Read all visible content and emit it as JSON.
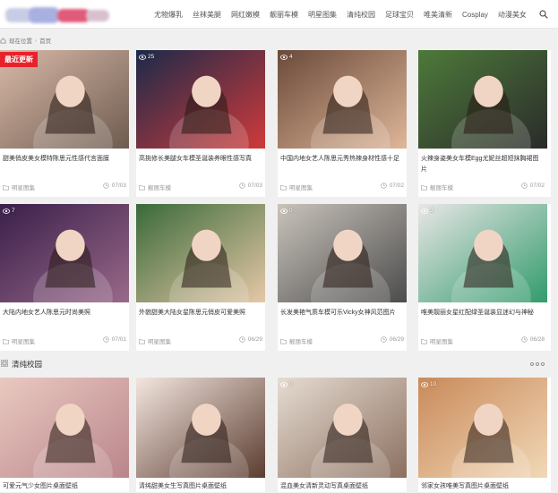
{
  "nav": {
    "items": [
      "尤物爆乳",
      "丝袜美腿",
      "网红嫩模",
      "靓丽车模",
      "明星图集",
      "清纯校园",
      "足球宝贝",
      "唯美清新",
      "Cosplay",
      "动漫美女"
    ]
  },
  "breadcrumb": {
    "current_label": "现在位置",
    "home_label": "首页"
  },
  "badge_new": "最近更新",
  "section": {
    "title": "清纯校园"
  },
  "cards": [
    {
      "title": "甜美俏皮美女模特陈思元性感代言面膜",
      "category": "明星图集",
      "date": "07/03",
      "views": "",
      "bg1": "#d9b9a8",
      "bg2": "#6c5a4e"
    },
    {
      "title": "高挑修长美腿女车模圣诞装养眼性感写真",
      "category": "靓丽车模",
      "date": "07/03",
      "views": "25",
      "bg1": "#1b2a4a",
      "bg2": "#d23a3a"
    },
    {
      "title": "中国内地女艺人陈思元秀热辣身材性感十足",
      "category": "明星图集",
      "date": "07/02",
      "views": "4",
      "bg1": "#6b4a3a",
      "bg2": "#e0b89a"
    },
    {
      "title": "火辣身姿美女车模Egg尤妮丝超短抹胸裙图片",
      "category": "靓丽车模",
      "date": "07/02",
      "views": "",
      "bg1": "#4d7a3a",
      "bg2": "#2a2a2a"
    },
    {
      "title": "大陆内地女艺人陈思元时尚美照",
      "category": "明星图集",
      "date": "07/01",
      "views": "7",
      "bg1": "#3a1f4a",
      "bg2": "#9a6a8a"
    },
    {
      "title": "外貌甜美大陆女星陈思元俏皮可爱美照",
      "category": "明星图集",
      "date": "06/29",
      "views": "",
      "bg1": "#3a6a3a",
      "bg2": "#e8c9a8"
    },
    {
      "title": "长发美艳气质车模可乐Vicky女神风范图片",
      "category": "靓丽车模",
      "date": "06/29",
      "views": "0",
      "bg1": "#c9c3bb",
      "bg2": "#4a4a4a"
    },
    {
      "title": "唯美靓丽女星红配绿圣诞装显迷幻与神秘",
      "category": "明星图集",
      "date": "06/28",
      "views": "3",
      "bg1": "#e9e6e6",
      "bg2": "#2f9a6a"
    }
  ],
  "cards2": [
    {
      "title": "可爱元气少女图片桌面壁纸",
      "views": "",
      "bg1": "#e9c9c0",
      "bg2": "#b9848a"
    },
    {
      "title": "清纯甜美女生写真图片桌面壁纸",
      "views": "",
      "bg1": "#f3e6df",
      "bg2": "#5a3a2e"
    },
    {
      "title": "混血美女清新灵动写真桌面壁纸",
      "views": "0",
      "bg1": "#e6dcd2",
      "bg2": "#8a6e5e"
    },
    {
      "title": "邻家女孩唯美写真图片桌面壁纸",
      "views": "10",
      "bg1": "#c98a5a",
      "bg2": "#f2d9b8"
    }
  ]
}
